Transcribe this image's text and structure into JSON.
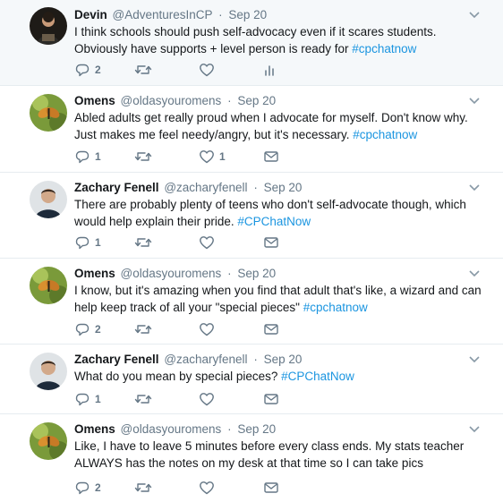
{
  "tweets": [
    {
      "name": "Devin",
      "handle": "@AdventuresInCP",
      "date": "Sep 20",
      "text_before": "I think schools should push self-advocacy even if it scares students. Obviously have supports + level person is ready for ",
      "hashtag": "#cpchatnow",
      "reply_count": "2",
      "retweet_count": "",
      "like_count": "",
      "extra_action": "analytics-icon",
      "highlight": true
    },
    {
      "name": "Omens",
      "handle": "@oldasyouromens",
      "date": "Sep 20",
      "text_before": "Abled adults get really proud when I advocate for myself. Don't know why. Just makes me feel needy/angry, but it's necessary. ",
      "hashtag": "#cpchatnow",
      "reply_count": "1",
      "retweet_count": "",
      "like_count": "1",
      "extra_action": "mail-icon",
      "highlight": false
    },
    {
      "name": "Zachary Fenell",
      "handle": "@zacharyfenell",
      "date": "Sep 20",
      "text_before": "There are probably plenty of teens who don't self-advocate though, which would help explain their pride. ",
      "hashtag": "#CPChatNow",
      "reply_count": "1",
      "retweet_count": "",
      "like_count": "",
      "extra_action": "mail-icon",
      "highlight": false
    },
    {
      "name": "Omens",
      "handle": "@oldasyouromens",
      "date": "Sep 20",
      "text_before": "I know, but it's amazing when you find that adult that's like, a wizard and can help keep track of all your \"special pieces\" ",
      "hashtag": "#cpchatnow",
      "reply_count": "2",
      "retweet_count": "",
      "like_count": "",
      "extra_action": "mail-icon",
      "highlight": false
    },
    {
      "name": "Zachary Fenell",
      "handle": "@zacharyfenell",
      "date": "Sep 20",
      "text_before": "What do you mean by special pieces? ",
      "hashtag": "#CPChatNow",
      "reply_count": "1",
      "retweet_count": "",
      "like_count": "",
      "extra_action": "mail-icon",
      "highlight": false
    },
    {
      "name": "Omens",
      "handle": "@oldasyouromens",
      "date": "Sep 20",
      "text_before": "Like, I have to leave 5 minutes before every class ends. My stats teacher ALWAYS has the notes on my desk at that time so I can take pics",
      "hashtag": "",
      "reply_count": "2",
      "retweet_count": "",
      "like_count": "",
      "extra_action": "mail-icon",
      "highlight": false
    }
  ],
  "colors": {
    "hashtag": "#1b95e0",
    "muted": "#657786",
    "divider": "#e6ecf0",
    "highlight_bg": "#f5f8fa"
  }
}
